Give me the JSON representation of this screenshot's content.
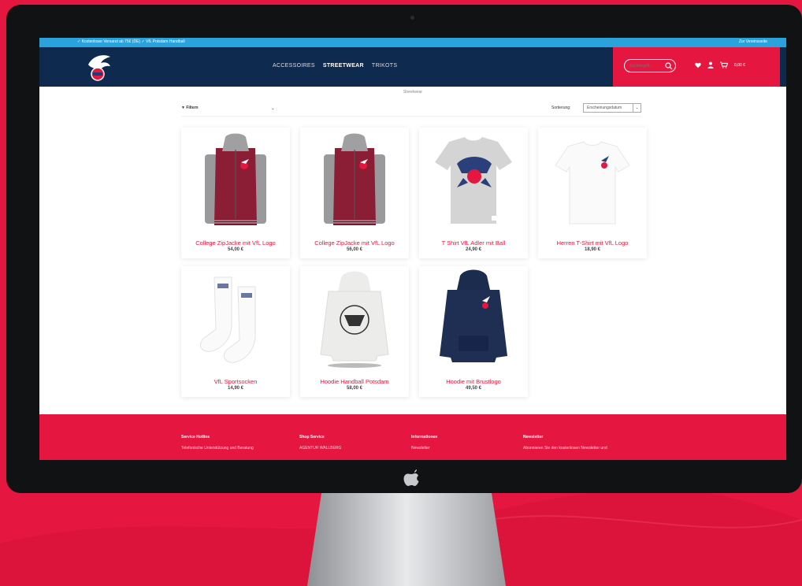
{
  "topbar": {
    "left": "✓ Kostenloser Versand ab 75€ (DE)   ✓ VfL Potsdam Handball",
    "right": "Zur Vereinsseite"
  },
  "header": {
    "nav": [
      {
        "label": "ACCESSOIRES",
        "active": false
      },
      {
        "label": "STREETWEAR",
        "active": true
      },
      {
        "label": "TRIKOTS",
        "active": false
      }
    ],
    "search_placeholder": "Suchbegriff...",
    "cart_total": "0,00 €"
  },
  "breadcrumb": "Streetwear",
  "filter": {
    "label": "▼ Filtern",
    "sort_label": "Sortierung:",
    "sort_value": "Erscheinungsdatum"
  },
  "products": [
    {
      "title": "College ZipJacke mit VfL Logo",
      "price": "54,00 €",
      "icon": "college-jacket"
    },
    {
      "title": "College ZipJacke mit VfL Logo",
      "price": "56,00 €",
      "icon": "college-jacket"
    },
    {
      "title": "T Shirt VfL Adler mit Ball",
      "price": "24,90 €",
      "icon": "grey-tshirt"
    },
    {
      "title": "Herren T-Shirt mit VfL Logo",
      "price": "18,90 €",
      "icon": "white-tshirt"
    },
    {
      "title": "VfL Sportsocken",
      "price": "14,90 €",
      "icon": "socks"
    },
    {
      "title": "Hoodie Handball Potsdam",
      "price": "58,00 €",
      "icon": "white-hoodie"
    },
    {
      "title": "Hoodie mit Brustlogo",
      "price": "49,50 €",
      "icon": "navy-hoodie"
    }
  ],
  "footer": {
    "columns": [
      {
        "heading": "Service Hotline",
        "text": "Telefonische Unterstützung und Beratung"
      },
      {
        "heading": "Shop Service",
        "text": "AGENTUR WALLBERG"
      },
      {
        "heading": "Informationen",
        "text": "Newsletter"
      },
      {
        "heading": "Newsletter",
        "text": "Abonnieren Sie den kostenlosen Newsletter und"
      }
    ]
  },
  "colors": {
    "brand_red": "#e5163f",
    "navy": "#0f2a4f",
    "topbar_blue": "#2aa3dc"
  }
}
